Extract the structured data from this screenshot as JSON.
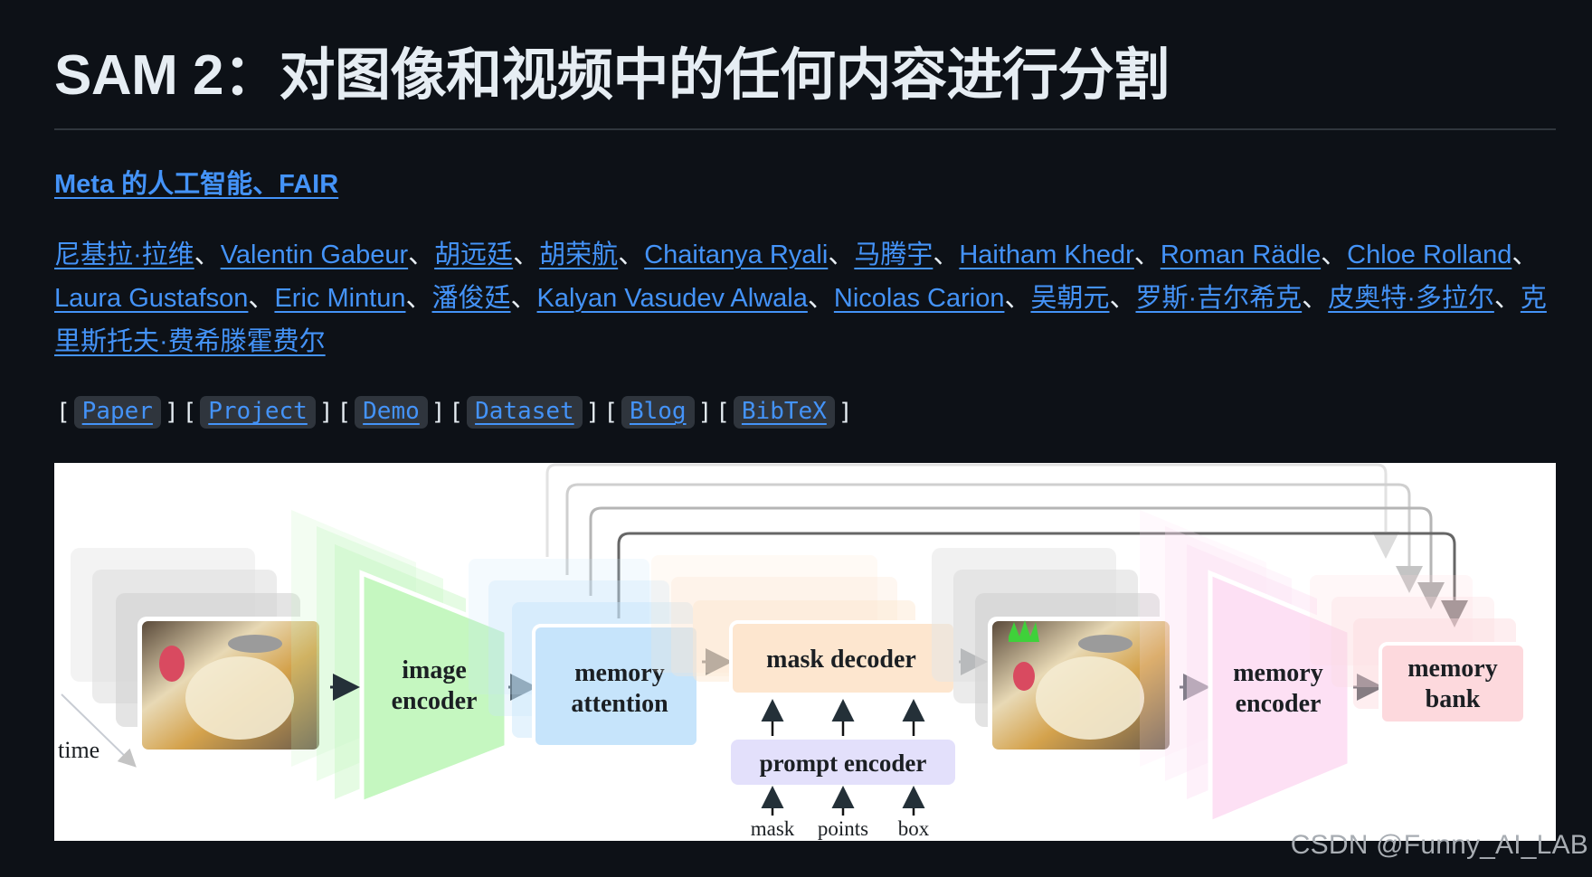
{
  "page": {
    "title": "SAM 2：对图像和视频中的任何内容进行分割",
    "affiliation": "Meta 的人工智能、FAIR",
    "authors": [
      "尼基拉·拉维",
      "Valentin Gabeur",
      "胡远廷",
      "胡荣航",
      "Chaitanya Ryali",
      "马腾宇",
      "Haitham Khedr",
      "Roman Rädle",
      "Chloe Rolland",
      "Laura Gustafson",
      "Eric Mintun",
      "潘俊廷",
      "Kalyan Vasudev Alwala",
      "Nicolas Carion",
      "吴朝元",
      "罗斯·吉尔希克",
      "皮奥特·多拉尔",
      "克里斯托夫·费希滕霍费尔"
    ],
    "author_separator": "、",
    "links": [
      "Paper",
      "Project",
      "Demo",
      "Dataset",
      "Blog",
      "BibTeX"
    ],
    "bracket_open": "[",
    "bracket_close": "]"
  },
  "figure": {
    "labels": {
      "time": "time",
      "image_encoder_1": "image",
      "image_encoder_2": "encoder",
      "memory_attention_1": "memory",
      "memory_attention_2": "attention",
      "mask_decoder": "mask decoder",
      "prompt_encoder": "prompt encoder",
      "memory_encoder_1": "memory",
      "memory_encoder_2": "encoder",
      "memory_bank_1": "memory",
      "memory_bank_2": "bank",
      "prompt_mask": "mask",
      "prompt_points": "points",
      "prompt_box": "box"
    },
    "colors": {
      "image_encoder": "#c5f7c0",
      "memory_attention": "#c6e4fb",
      "mask_decoder": "#fde6cf",
      "prompt_encoder": "#e3e0fb",
      "memory_encoder": "#fde0f4",
      "memory_bank": "#fdd9dd"
    }
  },
  "watermark": "CSDN @Funny_AI_LAB",
  "theme": {
    "background": "#0d1117",
    "text": "#e6edf3",
    "link": "#4493f8",
    "code_bg": "#2f353d"
  }
}
